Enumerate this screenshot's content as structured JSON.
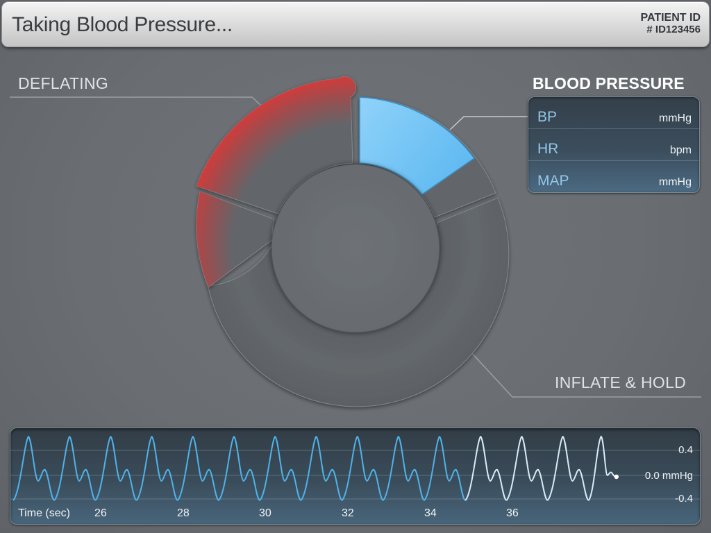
{
  "header": {
    "title": "Taking Blood Pressure...",
    "patient_label": "PATIENT ID",
    "patient_id": "# ID123456"
  },
  "gauge": {
    "status_label": "DEFLATING",
    "mode_label": "INFLATE & HOLD",
    "colors": {
      "deflate": "#c83a3a",
      "measure": "#6ec3f5",
      "ring": "#62666a"
    }
  },
  "blood_pressure": {
    "heading": "BLOOD PRESSURE",
    "rows": [
      {
        "label": "BP",
        "unit": "mmHg"
      },
      {
        "label": "HR",
        "unit": "bpm"
      },
      {
        "label": "MAP",
        "unit": "mmHg"
      }
    ]
  },
  "waveform": {
    "x_label": "Time (sec)",
    "x_ticks": [
      "26",
      "28",
      "30",
      "32",
      "34",
      "36"
    ],
    "y_ticks": [
      "0.4",
      "0.0 mmHg",
      "-0.4"
    ],
    "colors": {
      "trace": "#4fb3ea",
      "recent": "#d8ecf8"
    }
  }
}
